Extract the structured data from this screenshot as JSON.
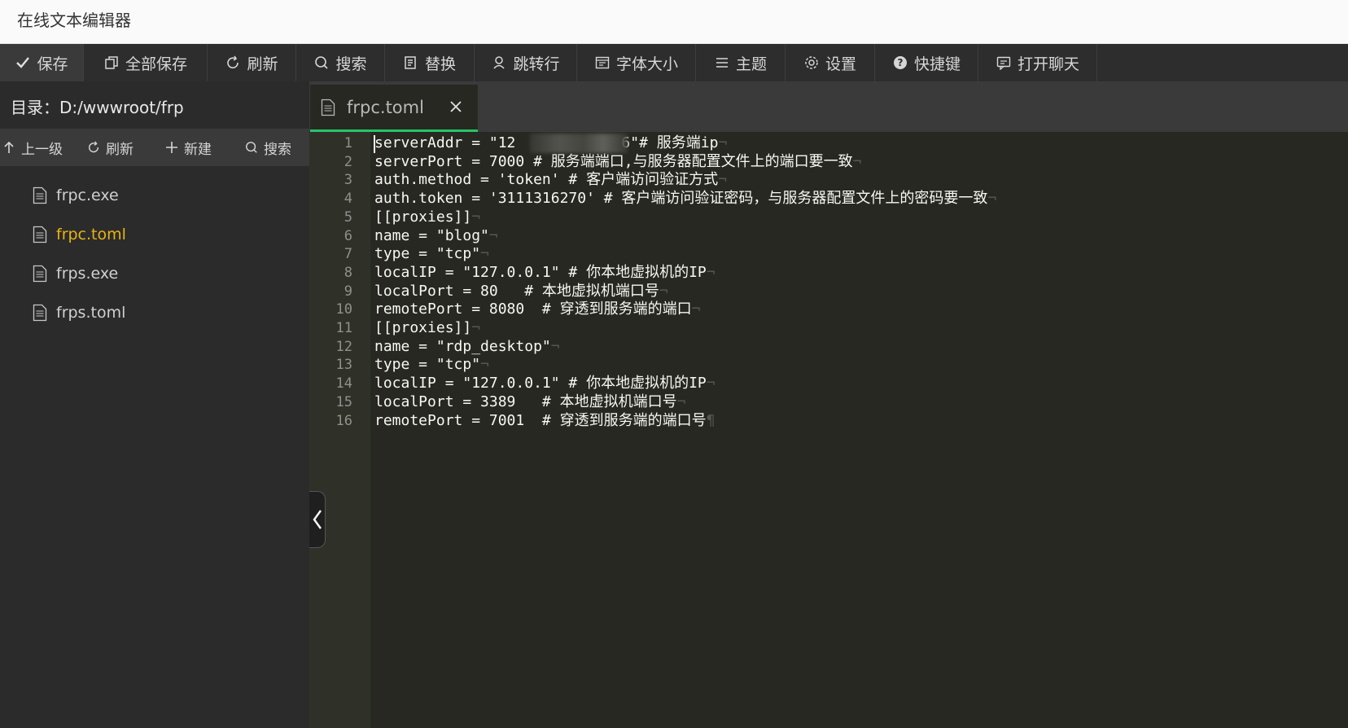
{
  "app": {
    "title": "在线文本编辑器"
  },
  "toolbar": {
    "items": [
      {
        "label": "保存",
        "icon": "check-icon"
      },
      {
        "label": "全部保存",
        "icon": "copy-icon"
      },
      {
        "label": "刷新",
        "icon": "refresh-icon"
      },
      {
        "label": "搜索",
        "icon": "search-icon"
      },
      {
        "label": "替换",
        "icon": "replace-icon"
      },
      {
        "label": "跳转行",
        "icon": "goto-line-icon"
      },
      {
        "label": "字体大小",
        "icon": "font-size-icon"
      },
      {
        "label": "主题",
        "icon": "menu-icon"
      },
      {
        "label": "设置",
        "icon": "gear-icon"
      },
      {
        "label": "快捷键",
        "icon": "help-icon"
      },
      {
        "label": "打开聊天",
        "icon": "chat-icon"
      }
    ]
  },
  "sidebar": {
    "dir_label": "目录：",
    "dir_path": "D:/wwwroot/frp",
    "tools": [
      {
        "label": "上一级",
        "icon": "arrow-up-icon"
      },
      {
        "label": "刷新",
        "icon": "refresh-icon"
      },
      {
        "label": "新建",
        "icon": "plus-icon"
      },
      {
        "label": "搜索",
        "icon": "search-icon"
      }
    ],
    "files": [
      {
        "name": "frpc.exe",
        "active": false
      },
      {
        "name": "frpc.toml",
        "active": true
      },
      {
        "name": "frps.exe",
        "active": false
      },
      {
        "name": "frps.toml",
        "active": false
      }
    ]
  },
  "editor": {
    "tab_name": "frpc.toml",
    "lines": [
      {
        "n": "1",
        "text": "serverAddr = \"12            6\"# 服务端ip"
      },
      {
        "n": "2",
        "text": "serverPort = 7000 # 服务端端口,与服务器配置文件上的端口要一致"
      },
      {
        "n": "3",
        "text": "auth.method = 'token' # 客户端访问验证方式"
      },
      {
        "n": "4",
        "text": "auth.token = '3111316270' # 客户端访问验证密码，与服务器配置文件上的密码要一致"
      },
      {
        "n": "5",
        "text": "[[proxies]]"
      },
      {
        "n": "6",
        "text": "name = \"blog\""
      },
      {
        "n": "7",
        "text": "type = \"tcp\""
      },
      {
        "n": "8",
        "text": "localIP = \"127.0.0.1\" # 你本地虚拟机的IP"
      },
      {
        "n": "9",
        "text": "localPort = 80   # 本地虚拟机端口号"
      },
      {
        "n": "10",
        "text": "remotePort = 8080  # 穿透到服务端的端口"
      },
      {
        "n": "11",
        "text": "[[proxies]]"
      },
      {
        "n": "12",
        "text": "name = \"rdp_desktop\""
      },
      {
        "n": "13",
        "text": "type = \"tcp\""
      },
      {
        "n": "14",
        "text": "localIP = \"127.0.0.1\" # 你本地虚拟机的IP"
      },
      {
        "n": "15",
        "text": "localPort = 3389   # 本地虚拟机端口号"
      },
      {
        "n": "16",
        "text": "remotePort = 7001  # 穿透到服务端的端口号"
      }
    ]
  },
  "colors": {
    "accent_green": "#27c46b",
    "active_file": "#e8b317",
    "editor_bg": "#272822"
  }
}
